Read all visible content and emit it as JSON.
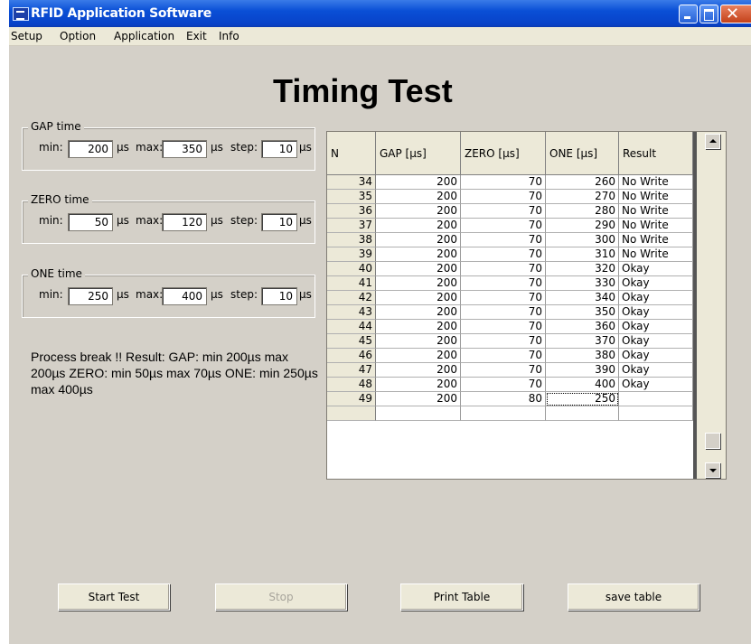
{
  "window": {
    "title": "RFID Application Software"
  },
  "menu": [
    "Setup",
    "Option",
    "Application",
    "Exit",
    "Info"
  ],
  "heading": "Timing Test",
  "gap": {
    "legend": "GAP time",
    "min_label": "min:",
    "min": "200",
    "max_label": "max:",
    "max": "350",
    "step_label": "step:",
    "step": "10",
    "unit": "µs"
  },
  "zero": {
    "legend": "ZERO time",
    "min_label": "min:",
    "min": "50",
    "max_label": "max:",
    "max": "120",
    "step_label": "step:",
    "step": "10",
    "unit": "µs"
  },
  "one": {
    "legend": "ONE time",
    "min_label": "min:",
    "min": "250",
    "max_label": "max:",
    "max": "400",
    "step_label": "step:",
    "step": "10",
    "unit": "µs"
  },
  "result_text": "Process break !!        Result:  GAP:  min 200µs  max 200µs  ZERO: min 50µs  max 70µs    ONE:  min 250µs  max 400µs",
  "table": {
    "headers": [
      "N",
      "GAP [µs]",
      "ZERO [µs]",
      "ONE [µs]",
      "Result"
    ],
    "rows": [
      [
        "34",
        "200",
        "70",
        "260",
        "No Write"
      ],
      [
        "35",
        "200",
        "70",
        "270",
        "No Write"
      ],
      [
        "36",
        "200",
        "70",
        "280",
        "No Write"
      ],
      [
        "37",
        "200",
        "70",
        "290",
        "No Write"
      ],
      [
        "38",
        "200",
        "70",
        "300",
        "No Write"
      ],
      [
        "39",
        "200",
        "70",
        "310",
        "No Write"
      ],
      [
        "40",
        "200",
        "70",
        "320",
        "Okay"
      ],
      [
        "41",
        "200",
        "70",
        "330",
        "Okay"
      ],
      [
        "42",
        "200",
        "70",
        "340",
        "Okay"
      ],
      [
        "43",
        "200",
        "70",
        "350",
        "Okay"
      ],
      [
        "44",
        "200",
        "70",
        "360",
        "Okay"
      ],
      [
        "45",
        "200",
        "70",
        "370",
        "Okay"
      ],
      [
        "46",
        "200",
        "70",
        "380",
        "Okay"
      ],
      [
        "47",
        "200",
        "70",
        "390",
        "Okay"
      ],
      [
        "48",
        "200",
        "70",
        "400",
        "Okay"
      ],
      [
        "49",
        "200",
        "80",
        "250",
        ""
      ],
      [
        "",
        "",
        "",
        "",
        ""
      ]
    ]
  },
  "buttons": {
    "start": "Start Test",
    "stop": "Stop",
    "print": "Print Table",
    "save": "save table"
  }
}
